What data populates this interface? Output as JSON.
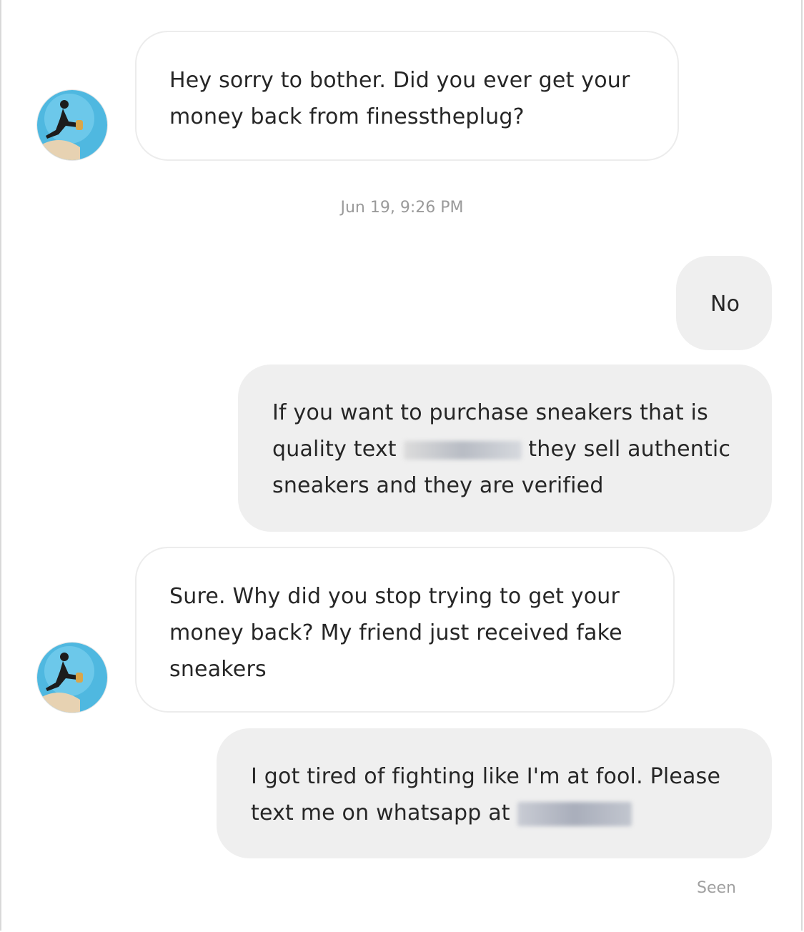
{
  "thread": {
    "timestamp": "Jun 19, 9:26 PM",
    "seen_label": "Seen",
    "avatar_icon": "profile-avatar-icon",
    "messages": [
      {
        "from": "them",
        "text": "Hey sorry to bother. Did you ever get your money back from finesstheplug?"
      },
      {
        "from": "me",
        "text": "No"
      },
      {
        "from": "me",
        "text_before": "If you want to purchase sneakers that is quality text",
        "text_after": "they sell authentic sneakers and they are verified",
        "redacted": true
      },
      {
        "from": "them",
        "text": "Sure. Why did you stop trying to get your money back? My friend just received fake sneakers"
      },
      {
        "from": "me",
        "text_before": "I got tired of fighting like I'm at fool. Please text me on whatsapp at",
        "redacted": true
      }
    ]
  },
  "colors": {
    "incoming_bubble": "#ffffff",
    "outgoing_bubble": "#efefef",
    "text": "#262626",
    "meta_text": "#9a9a9a"
  }
}
